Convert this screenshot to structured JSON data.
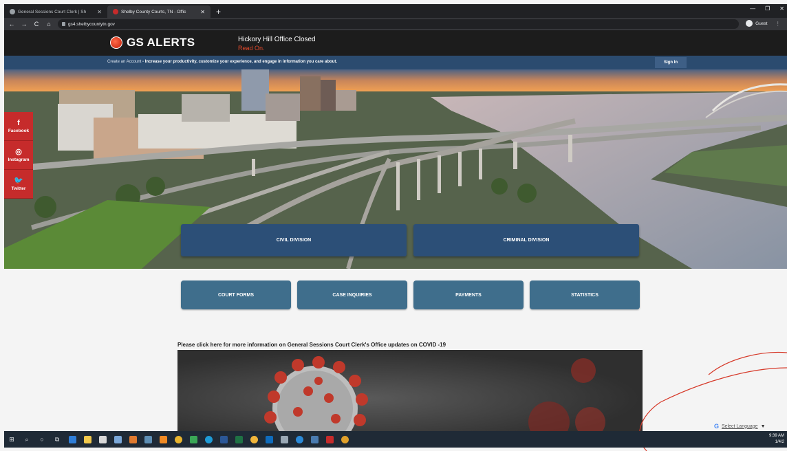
{
  "browser": {
    "tabs": [
      {
        "title": "General Sessions Court Clerk | Sh",
        "active": false
      },
      {
        "title": "Shelby County Courts, TN - Offic",
        "active": true
      }
    ],
    "url": "gs4.shelbycountytn.gov",
    "profile": "Guest"
  },
  "header": {
    "brand": "GS ALERTS",
    "notice_title": "Hickory Hill Office Closed",
    "notice_link": "Read On."
  },
  "account_bar": {
    "link": "Create an Account",
    "message": " - Increase your productivity, customize your experience, and engage in information you care about.",
    "sign_in": "Sign In"
  },
  "social": [
    {
      "icon": "facebook-icon",
      "glyph": "f",
      "label": "Facebook"
    },
    {
      "icon": "instagram-icon",
      "glyph": "◎",
      "label": "Instagram"
    },
    {
      "icon": "twitter-icon",
      "glyph": "🐦",
      "label": "Twitter"
    }
  ],
  "divisions": {
    "civil": "CIVIL DIVISION",
    "criminal": "CRIMINAL DIVISION"
  },
  "services": [
    "COURT FORMS",
    "CASE INQUIRIES",
    "PAYMENTS",
    "STATISTICS"
  ],
  "covid": {
    "link_text": "Please click here for more information on General Sessions Court Clerk's Office updates on COVID -19"
  },
  "translate": {
    "label": "Select Language"
  },
  "taskbar": {
    "time": "9:39 AM",
    "date": "1/4/2"
  }
}
